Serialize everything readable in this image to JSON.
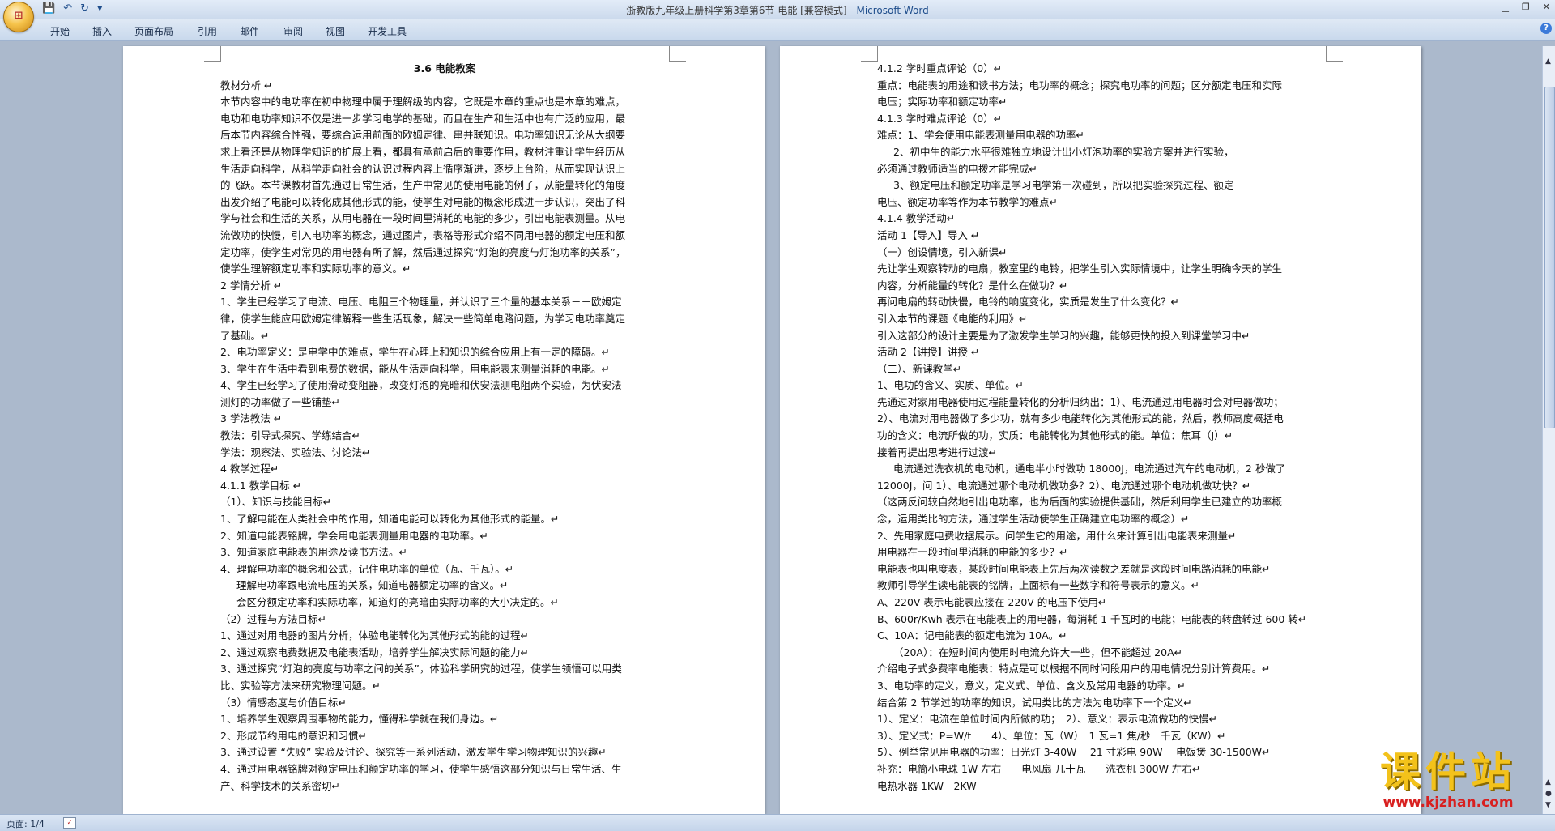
{
  "window": {
    "title": "浙教版九年级上册科学第3章第6节 电能 [兼容模式]",
    "app_name": "Microsoft Word",
    "title_sep": " - "
  },
  "qat": {
    "save": "💾",
    "undo": "↶",
    "redo": "↻",
    "more": "▾"
  },
  "ribbon": {
    "tabs": [
      "开始",
      "插入",
      "页面布局",
      "引用",
      "邮件",
      "审阅",
      "视图",
      "开发工具"
    ]
  },
  "status": {
    "page": "页面: 1/4"
  },
  "watermark": {
    "big": "课件站",
    "small": "www.kjzhan.com"
  },
  "left_page": {
    "lines": [
      "3.6 电能教案",
      "教材分析 ↵",
      "本节内容中的电功率在初中物理中属于理解级的内容，它既是本章的重点也是本章的难点，",
      "电功和电功率知识不仅是进一步学习电学的基础，而且在生产和生活中也有广泛的应用，最",
      "后本节内容综合性强，要综合运用前面的欧姆定律、串并联知识。电功率知识无论从大纲要",
      "求上看还是从物理学知识的扩展上看，都具有承前启后的重要作用，教材注重让学生经历从",
      "生活走向科学，从科学走向社会的认识过程内容上循序渐进，逐步上台阶，从而实现认识上",
      "的飞跃。本节课教材首先通过日常生活，生产中常见的使用电能的例子，从能量转化的角度",
      "出发介绍了电能可以转化成其他形式的能，使学生对电能的概念形成进一步认识，突出了科",
      "学与社会和生活的关系，从用电器在一段时间里消耗的电能的多少，引出电能表测量。从电",
      "流做功的快慢，引入电功率的概念，通过图片，表格等形式介绍不同用电器的额定电压和额",
      "定功率，使学生对常见的用电器有所了解，然后通过探究“灯泡的亮度与灯泡功率的关系”，",
      "使学生理解额定功率和实际功率的意义。↵",
      "2 学情分析 ↵",
      "1、学生已经学习了电流、电压、电阻三个物理量，并认识了三个量的基本关系－－欧姆定",
      "律，使学生能应用欧姆定律解释一些生活现象，解决一些简单电路问题，为学习电功率奠定",
      "了基础。↵",
      "2、电功率定义：是电学中的难点，学生在心理上和知识的综合应用上有一定的障碍。↵",
      "3、学生在生活中看到电费的数据，能从生活走向科学，用电能表来测量消耗的电能。↵",
      "4、学生已经学习了使用滑动变阻器，改变灯泡的亮暗和伏安法测电阻两个实验，为伏安法",
      "测灯的功率做了一些铺垫↵",
      "3 学法教法 ↵",
      "教法：引导式探究、学练结合↵",
      "学法：观察法、实验法、讨论法↵",
      "4 教学过程↵",
      "4.1.1 教学目标 ↵",
      "（1）、知识与技能目标↵",
      "1、了解电能在人类社会中的作用，知道电能可以转化为其他形式的能量。↵",
      "2、知道电能表铭牌，学会用电能表测量用电器的电功率。↵",
      "3、知道家庭电能表的用途及读书方法。↵",
      "4、理解电功率的概念和公式，记住电功率的单位（瓦、千瓦）。↵",
      "理解电功率跟电流电压的关系，知道电器额定功率的含义。↵",
      "会区分额定功率和实际功率，知道灯的亮暗由实际功率的大小决定的。↵",
      "（2）过程与方法目标↵",
      "1、通过对用电器的图片分析，体验电能转化为其他形式的能的过程↵",
      "2、通过观察电费数据及电能表活动，培养学生解决实际问题的能力↵",
      "3、通过探究“灯泡的亮度与功率之间的关系”，体验科学研究的过程，使学生领悟可以用类",
      "比、实验等方法来研究物理问题。↵",
      "（3）情感态度与价值目标↵",
      "1、培养学生观察周围事物的能力，懂得科学就在我们身边。↵",
      "2、形成节约用电的意识和习惯↵",
      "3、通过设置 “失败” 实验及讨论、探究等一系列活动，激发学生学习物理知识的兴趣↵",
      "4、通过用电器铭牌对额定电压和额定功率的学习，使学生感悟这部分知识与日常生活、生",
      "产、科学技术的关系密切↵"
    ]
  },
  "right_page": {
    "lines": [
      "4.1.2 学时重点评论（0）↵",
      "重点：电能表的用途和读书方法；电功率的概念；探究电功率的问题；区分额定电压和实际",
      "电压；实际功率和额定功率↵",
      "4.1.3 学时难点评论（0）↵",
      "难点：1、学会使用电能表测量用电器的功率↵",
      "2、初中生的能力水平很难独立地设计出小灯泡功率的实验方案并进行实验，",
      "必须通过教师适当的电拨才能完成↵",
      "3、额定电压和额定功率是学习电学第一次碰到，所以把实验探究过程、额定",
      "电压、额定功率等作为本节教学的难点↵",
      "4.1.4 教学活动↵",
      "活动 1【导入】导入 ↵",
      "（一）创设情境，引入新课↵",
      "先让学生观察转动的电扇，教室里的电铃，把学生引入实际情境中，让学生明确今天的学生",
      "内容，分析能量的转化？是什么在做功？↵",
      "再问电扇的转动快慢，电铃的响度变化，实质是发生了什么变化？↵",
      "引入本节的课题《电能的利用》↵",
      "引入这部分的设计主要是为了激发学生学习的兴趣，能够更快的投入到课堂学习中↵",
      "活动 2【讲授】讲授 ↵",
      "（二）、新课教学↵",
      "1、电功的含义、实质、单位。↵",
      "先通过对家用电器使用过程能量转化的分析归纳出：1）、电流通过用电器时会对电器做功；",
      "2）、电流对用电器做了多少功，就有多少电能转化为其他形式的能，然后，教师高度概括电",
      "功的含义：电流所做的功，实质：电能转化为其他形式的能。单位：焦耳（J）↵",
      "接着再提出思考进行过渡↵",
      "电流通过洗衣机的电动机，通电半小时做功 18000J，电流通过汽车的电动机，2 秒做了",
      "12000J，问 1）、电流通过哪个电动机做功多？2）、电流通过哪个电动机做功快？↵",
      "（这两反问较自然地引出电功率，也为后面的实验提供基础，然后利用学生已建立的功率概",
      "念，运用类比的方法，通过学生活动使学生正确建立电功率的概念）↵",
      "2、先用家庭电费收据展示。问学生它的用途，用什么来计算引出电能表来测量↵",
      "用电器在一段时间里消耗的电能的多少？↵",
      "电能表也叫电度表，某段时间电能表上先后两次读数之差就是这段时间电路消耗的电能↵",
      "教师引导学生读电能表的铭牌，上面标有一些数字和符号表示的意义。↵",
      "A、220V 表示电能表应接在 220V 的电压下使用↵",
      "B、600r/Kwh 表示在电能表上的用电器，每消耗 1 千瓦时的电能；电能表的转盘转过 600 转↵",
      "C、10A：记电能表的额定电流为 10A。↵",
      "（20A）：在短时间内使用时电流允许大一些，但不能超过 20A↵",
      "介绍电子式多费率电能表：特点是可以根据不同时间段用户的用电情况分别计算费用。↵",
      "3、电功率的定义，意义，定义式、单位、含义及常用电器的功率。↵",
      "结合第 2 节学过的功率的知识，试用类比的方法为电功率下一个定义↵",
      "1）、定义：电流在单位时间内所做的功；　2）、意义：表示电流做功的快慢↵",
      "3）、定义式：P=W/t　　4）、单位：瓦（W）　1 瓦=1 焦/秒　千瓦（KW）↵",
      "5）、例举常见用电器的功率：日光灯 3-40W　 21 寸彩电 90W　 电饭煲 30-1500W↵",
      "补充：电筒小电珠 1W 左右　　电风扇 几十瓦　　洗衣机 300W 左右↵",
      "电热水器 1KW－2KW"
    ]
  }
}
